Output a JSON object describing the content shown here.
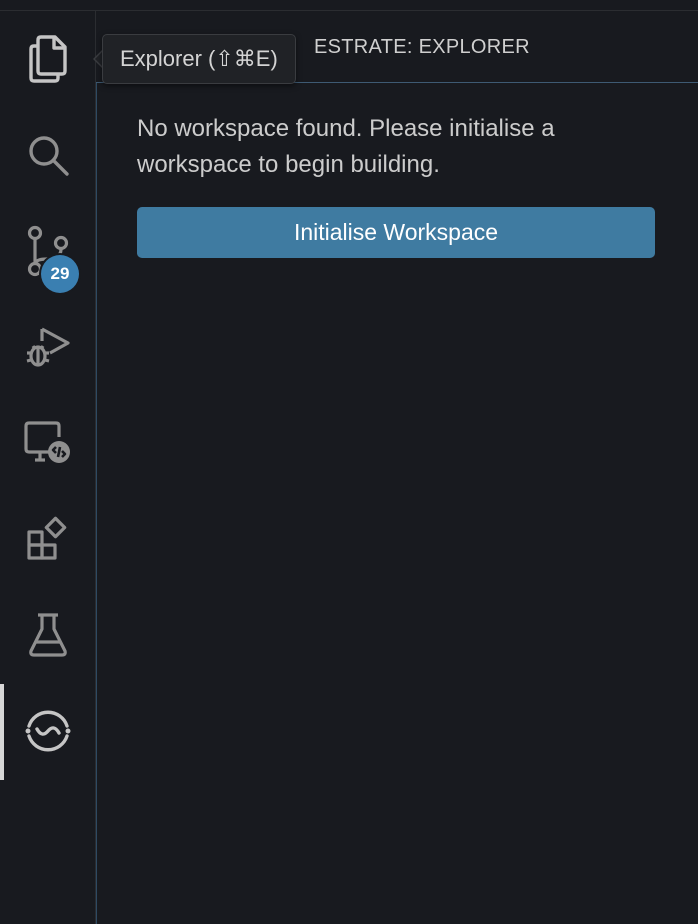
{
  "activity_bar": {
    "items": [
      {
        "name": "explorer",
        "icon": "files-icon"
      },
      {
        "name": "search",
        "icon": "search-icon"
      },
      {
        "name": "source-control",
        "icon": "source-control-icon",
        "badge": "29"
      },
      {
        "name": "run-and-debug",
        "icon": "run-debug-icon"
      },
      {
        "name": "remote-explorer",
        "icon": "remote-explorer-icon"
      },
      {
        "name": "extensions",
        "icon": "extensions-icon"
      },
      {
        "name": "testing",
        "icon": "beaker-icon"
      },
      {
        "name": "orchestrate",
        "icon": "orchestrate-icon"
      }
    ],
    "active_item": "orchestrate"
  },
  "tooltip": {
    "text": "Explorer (⇧⌘E)"
  },
  "sidebar": {
    "title": "ESTRATE: EXPLORER",
    "message": "No workspace found. Please initialise a workspace to begin building.",
    "button_label": "Initialise Workspace"
  },
  "colors": {
    "background": "#181a1f",
    "accent_button": "#3f7ba1",
    "badge": "#3a7fb1",
    "icon": "#c5c5c5"
  }
}
